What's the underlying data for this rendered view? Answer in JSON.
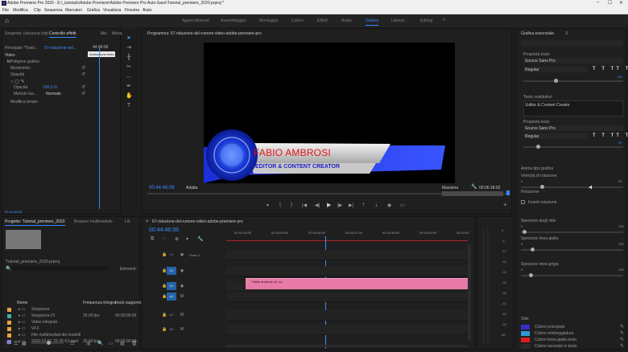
{
  "window": {
    "title": "Adobe Premiere Pro 2020 - E:\\_tutorials\\Adobe Premiere\\Adobe Premiere Pro Auto-Save\\Tutorial_premiere_2020.prproj *",
    "logo_text": "Pr",
    "controls": [
      "–",
      "☐",
      "✕"
    ]
  },
  "menu": [
    "File",
    "Modifica",
    "Clip",
    "Sequenza",
    "Marcatori",
    "Grafica",
    "Visualizza",
    "Finestra",
    "Aiuto"
  ],
  "workspaces": {
    "items": [
      "Apprendimento",
      "Assemblaggio",
      "Montaggio",
      "Colore",
      "Effetti",
      "Audio",
      "Grafica",
      "Librerie",
      "Editing"
    ],
    "active": "Grafica"
  },
  "effects_panel": {
    "tabs": [
      "Sorgente: (nessuna clip)",
      "Controllo effetti",
      "Mix",
      "Metadati"
    ],
    "active_tab": "Controllo effetti",
    "master_label": "Principale *Testo...",
    "clip_label": "67-riduzione-del...",
    "time_label": "44:46:00",
    "tooltip": "Animazione testo",
    "section_video": "Video",
    "rows": [
      "Poligono grafico",
      "Movimento",
      "Opacità",
      "Opacità",
      "Metodo fus...",
      "Modifica tempo"
    ],
    "opacity_value": "100,0 %",
    "blend_value": "Normale",
    "bottom_time": "00:44:46:06"
  },
  "program_monitor": {
    "title": "Programma: 67-riduzione-del-rumore-video-adobe-premiere-pro",
    "lower_third": {
      "name": "FABIO AMBROSI",
      "role": "EDITOR & CONTENT CREATOR"
    },
    "timecode": "00:44:46:06",
    "fit": "Adatta",
    "quality": "Massima",
    "duration": "00:06:18:02"
  },
  "project_panel": {
    "tabs": [
      "Progetto: Tutorial_premiere_2020",
      "Browser multimediale",
      "Lib"
    ],
    "active_tab": "Progetto: Tutorial_premiere_2020",
    "file": "Tutorial_premiere_2020.prproj",
    "count": "Elementi:",
    "columns": [
      "Nome",
      "Frequenza fotogra",
      "Inizio supporto"
    ],
    "items": [
      {
        "name": "Sequenze",
        "fps": "",
        "start": "",
        "color": "#e8a33a"
      },
      {
        "name": "Sequenza 01",
        "fps": "25,00 fps",
        "start": "00:00:00:00",
        "color": "#3fb0a4"
      },
      {
        "name": "Video integrati",
        "fps": "",
        "start": "",
        "color": "#e8a33a"
      },
      {
        "name": "VFX",
        "fps": "",
        "start": "",
        "color": "#e8a33a"
      },
      {
        "name": "File multimediali dei modelli",
        "fps": "",
        "start": "",
        "color": "#e8a33a"
      },
      {
        "name": "2020-02-01 20-25-53.mp4",
        "fps": "25,00 fps",
        "start": "00:00:00:00",
        "color": "#7d7dd6"
      }
    ]
  },
  "timeline": {
    "tab": "67-riduzione-del-rumore-video-adobe-premiere-pro",
    "timecode": "00:44:46:06",
    "ruler": [
      "00:44:44:00",
      "00:44:45:00",
      "00:44:46:00",
      "00:44:47:00",
      "00:44:48:00",
      "00:44:49:00",
      "00:44:50"
    ],
    "playhead_fraction": 0.41,
    "tracks": [
      {
        "id": "V3",
        "label": "Video 3"
      },
      {
        "id": "V2",
        "label": ""
      },
      {
        "id": "V1",
        "label": ""
      },
      {
        "id": "A1",
        "label": ""
      },
      {
        "id": "A2",
        "label": ""
      },
      {
        "id": "A3",
        "label": ""
      }
    ],
    "clip_label": "Fabio ambrosi ed. co."
  },
  "meter_labels": [
    "0",
    "-6",
    "-12",
    "-18",
    "-24",
    "-30",
    "-36",
    "-42",
    "-48",
    "-54",
    "dB"
  ],
  "essential_graphics": {
    "title": "Grafica essenziale",
    "text_props_1": "Proprietà testo",
    "font_1": "Source Sans Pro",
    "style_1": "Regular",
    "font_size_1": "125",
    "text_field_label": "Testo sostitutivo",
    "text_field_value": "Editor & Content Creator",
    "text_props_2": "Proprietà testo",
    "font_2": "Source Sans Pro",
    "style_2": "Regular",
    "font_size_2": "90",
    "effects_label": "Anima tipo grafica",
    "slider_rows": [
      {
        "label": "Velocità di rotazione",
        "min": "0",
        "max": "25",
        "value": 0.2
      },
      {
        "label": "Rotazione",
        "min": "",
        "max": "",
        "value": null
      },
      {
        "label": "Spessore degli stile",
        "min": "0",
        "max": "100",
        "value": 0.02
      },
      {
        "label": "Spessore linea gialla",
        "min": "0",
        "max": "100",
        "value": 0.1
      },
      {
        "label": "Spessore linea grigia",
        "min": "0",
        "max": "100",
        "value": 0.08
      }
    ],
    "checkbox_label": "Inverti rotazione",
    "colors_label": "Stile",
    "colors": [
      {
        "label": "Colore principale",
        "hex": "#3a2cc8"
      },
      {
        "label": "Colore ombreggiatura",
        "hex": "#2c9bd8"
      },
      {
        "label": "Colore linea gialla testo",
        "hex": "#e01a1a"
      },
      {
        "label": "Colore secondo in testo",
        "hex": "#2a2a2a"
      }
    ]
  }
}
